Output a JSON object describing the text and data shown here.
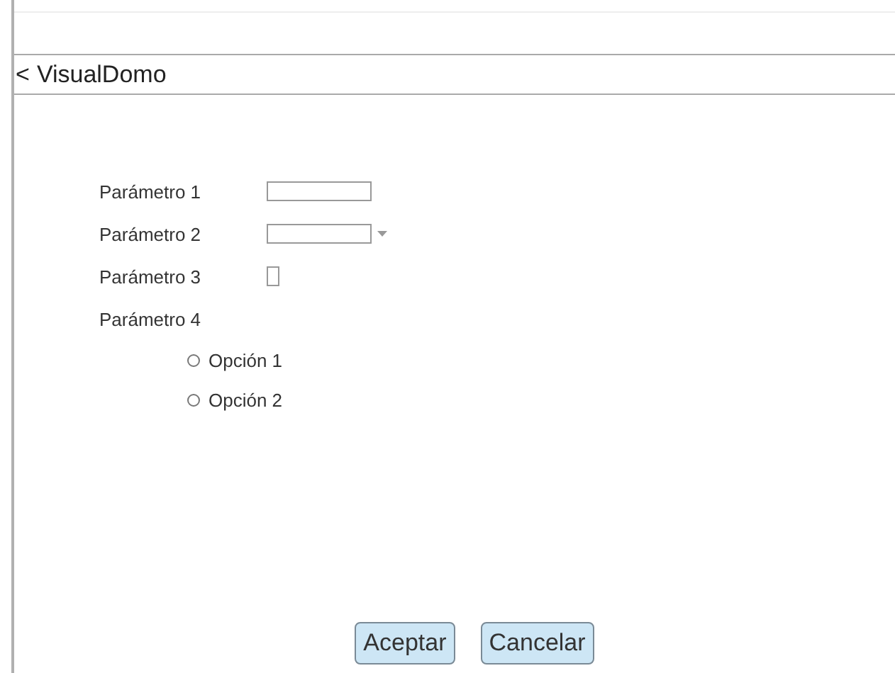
{
  "header": {
    "back": "<",
    "title": "VisualDomo"
  },
  "params": [
    {
      "kind": "text",
      "label": "Parámetro 1"
    },
    {
      "kind": "dropdown",
      "label": "Parámetro 2"
    },
    {
      "kind": "checkbox",
      "label": "Parámetro 3",
      "checked": false
    },
    {
      "kind": "radio",
      "label": "Parámetro 4",
      "options": [
        {
          "label": "Opción 1",
          "selected": false
        },
        {
          "label": "Opción 2",
          "selected": false
        }
      ]
    }
  ],
  "buttons": [
    "Aceptar",
    "Cancelar"
  ]
}
